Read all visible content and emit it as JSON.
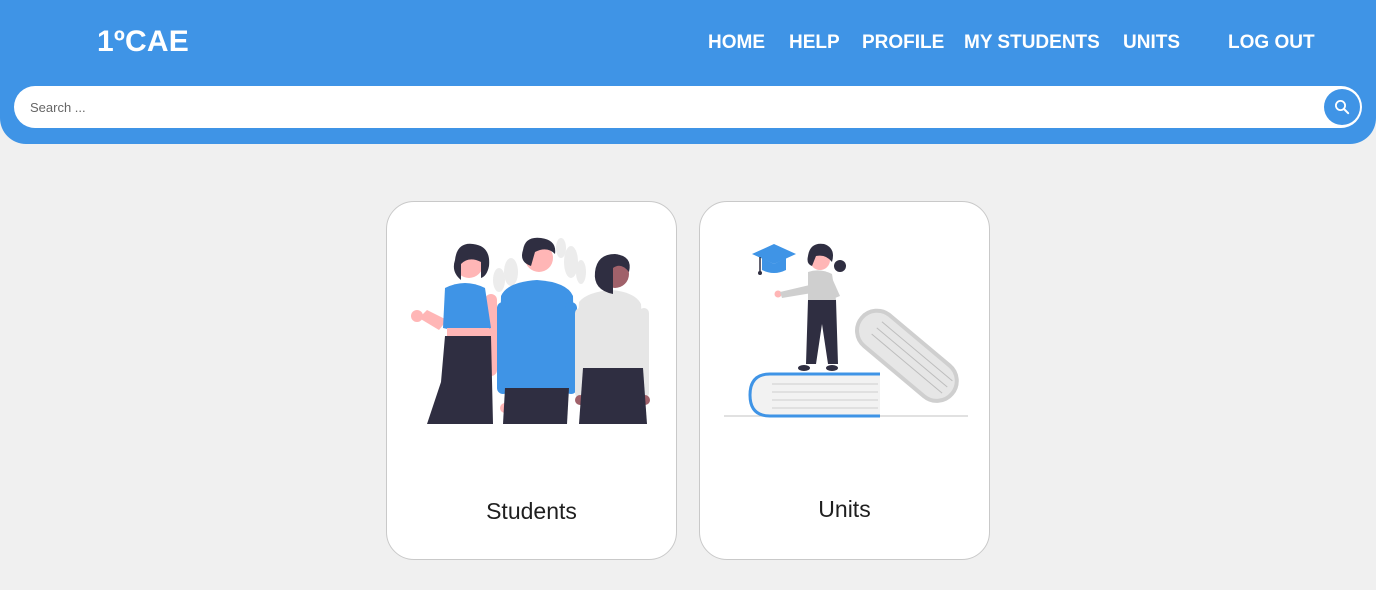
{
  "brand": "1ºCAE",
  "nav": {
    "home": "HOME",
    "help": "HELP",
    "profile": "PROFILE",
    "my_students": "MY STUDENTS",
    "units": "UNITS",
    "logout": "LOG OUT"
  },
  "search": {
    "placeholder": "Search ...",
    "value": "",
    "icon": "search-icon"
  },
  "cards": [
    {
      "label": "Students",
      "illustration": "three-people-illustration"
    },
    {
      "label": "Units",
      "illustration": "graduate-on-books-illustration"
    }
  ],
  "colors": {
    "primary": "#3f94e6",
    "background": "#f0f0f0",
    "card": "#ffffff",
    "dark": "#2f2e41",
    "skin": "#ffb6b6"
  }
}
